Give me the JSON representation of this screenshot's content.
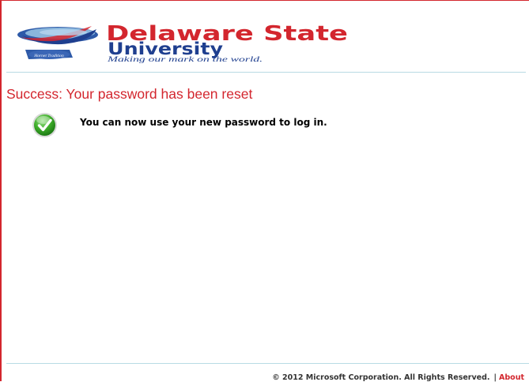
{
  "logo": {
    "name_line1": "Delaware State",
    "name_line2": "University",
    "tagline": "Making our mark on the world.",
    "seal_text": "Hornet Tradition",
    "colors": {
      "red": "#d3262e",
      "blue": "#1f3f8f",
      "light_blue": "#8ab6dc"
    }
  },
  "status": {
    "heading": "Success:  Your password has been reset",
    "message": "You can now use your new password to log in.",
    "icon": "success-check-icon"
  },
  "footer": {
    "copyright": "© 2012 Microsoft Corporation. All Rights Reserved.",
    "separator": "|",
    "about_link": "About"
  }
}
